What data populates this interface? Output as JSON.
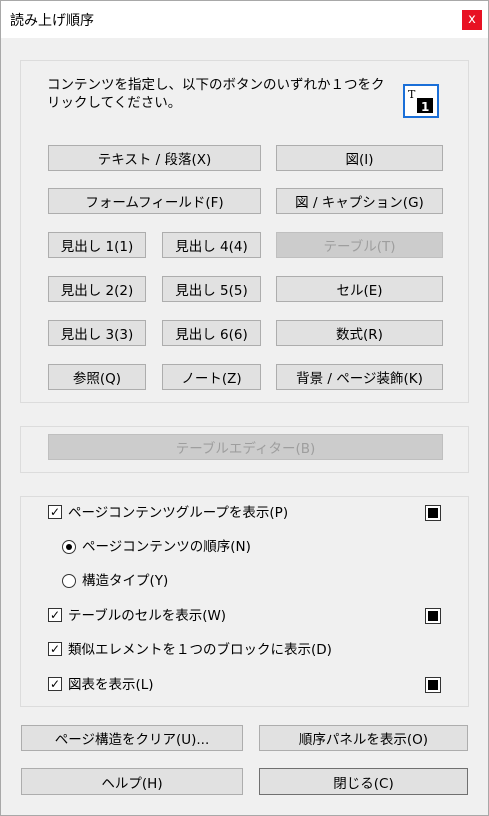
{
  "window": {
    "title": "読み上げ順序",
    "close_glyph": "x"
  },
  "tag_section": {
    "instruction": "コンテンツを指定し、以下のボタンのいずれか１つをクリックしてください。",
    "buttons": {
      "text_paragraph": "テキスト / 段落(X)",
      "figure": "図(I)",
      "form_field": "フォームフィールド(F)",
      "figure_caption": "図 / キャプション(G)",
      "heading1": "見出し 1(1)",
      "heading4": "見出し 4(4)",
      "table": "テーブル(T)",
      "heading2": "見出し 2(2)",
      "heading5": "見出し 5(5)",
      "cell": "セル(E)",
      "heading3": "見出し 3(3)",
      "heading6": "見出し 6(6)",
      "formula": "数式(R)",
      "reference": "参照(Q)",
      "note": "ノート(Z)",
      "background": "背景 / ページ装飾(K)"
    }
  },
  "table_editor": {
    "label": "テーブルエディター(B)"
  },
  "options": {
    "show_page_groups": {
      "label": "ページコンテンツグループを表示(P)",
      "checked": true
    },
    "order_page_content": {
      "label": "ページコンテンツの順序(N)",
      "selected": true
    },
    "structure_types": {
      "label": "構造タイプ(Y)",
      "selected": false
    },
    "show_table_cells": {
      "label": "テーブルのセルを表示(W)",
      "checked": true
    },
    "similar_elements": {
      "label": "類似エレメントを１つのブロックに表示(D)",
      "checked": true
    },
    "show_figures": {
      "label": "図表を表示(L)",
      "checked": true
    },
    "check_glyph": "✓",
    "swatch_color": "#000000"
  },
  "footer": {
    "clear_structure": "ページ構造をクリア(U)...",
    "show_order_panel": "順序パネルを表示(O)",
    "help": "ヘルプ(H)",
    "close": "閉じる(C)"
  }
}
